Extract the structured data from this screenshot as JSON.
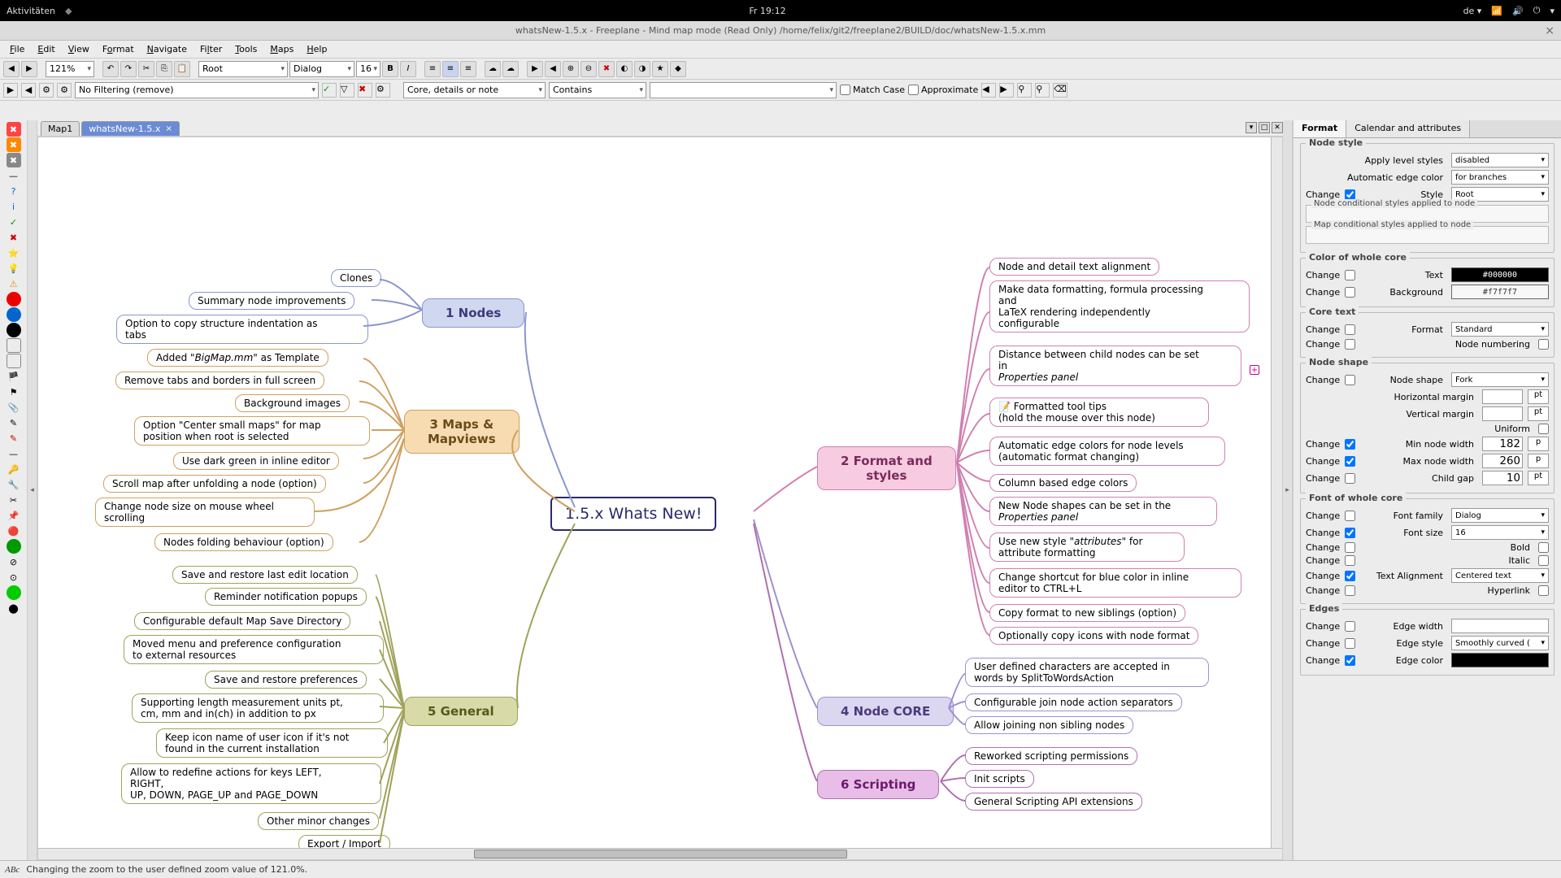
{
  "topbar": {
    "activities": "Aktivitäten",
    "clock": "Fr 19:12",
    "lang": "de ▾"
  },
  "titlebar": {
    "text": "whatsNew-1.5.x - Freeplane - Mind map mode (Read Only) /home/felix/git2/freeplane2/BUILD/doc/whatsNew-1.5.x.mm"
  },
  "menu": [
    "File",
    "Edit",
    "View",
    "Format",
    "Navigate",
    "Filter",
    "Tools",
    "Maps",
    "Help"
  ],
  "toolbar": {
    "zoom": "121%",
    "style": "Root",
    "font": "Dialog",
    "fsize": "16"
  },
  "filter": {
    "mode": "No Filtering (remove)",
    "scope": "Core, details or note",
    "op": "Contains",
    "matchcase": "Match Case",
    "approx": "Approximate"
  },
  "tabs": {
    "t1": "Map1",
    "t2": "whatsNew-1.5.x"
  },
  "root": "1.5.x Whats New!",
  "branches": {
    "n1": "1 Nodes",
    "n3": "3 Maps &\nMapviews",
    "n5": "5 General",
    "n2": "2 Format and\nstyles",
    "n4": "4 Node CORE",
    "n6": "6 Scripting"
  },
  "n1leaves": [
    "Clones",
    "Summary node improvements",
    "Option to copy structure indentation as\ntabs"
  ],
  "n3leaves": [
    "Added \"BigMap.mm\" as Template",
    "Remove tabs and borders in full screen",
    "Background images",
    "Option \"Center small maps\" for map\nposition when root is selected",
    "Use dark green in inline editor",
    "Scroll map after unfolding a node (option)",
    "Change node size on mouse wheel\nscrolling",
    "Nodes folding behaviour (option)"
  ],
  "n5leaves": [
    "Save and restore last edit location",
    "Reminder notification popups",
    "Configurable default Map Save Directory",
    "Moved menu and preference configuration\nto external resources",
    "Save and restore preferences",
    "Supporting length measurement units pt,\ncm, mm and in(ch) in addition to px",
    "Keep icon name of user icon if it's not\nfound in the current installation",
    "Allow to redefine actions for keys LEFT,\nRIGHT,\nUP, DOWN, PAGE_UP and PAGE_DOWN",
    "Other minor changes",
    "Export / Import"
  ],
  "n2leaves": [
    "Node and detail text alignment",
    "Make data formatting, formula processing\nand\nLaTeX rendering independently\nconfigurable",
    "Distance between child nodes can be set\nin\nProperties panel",
    "📝 Formatted tool tips\n(hold the mouse over this node)",
    "Automatic edge colors for node levels\n(automatic format changing)",
    "Column based edge colors",
    "New Node shapes can be set in the\nProperties panel",
    "Use new style \"attributes\" for\nattribute formatting",
    "Change shortcut for blue color in inline\neditor to CTRL+L",
    "Copy format to new siblings (option)",
    "Optionally copy icons with node format"
  ],
  "n4leaves": [
    "User defined characters are accepted in\nwords by SplitToWordsAction",
    "Configurable join node action separators",
    "Allow joining non sibling nodes"
  ],
  "n6leaves": [
    "Reworked scripting permissions",
    "Init scripts",
    "General Scripting API extensions"
  ],
  "panel": {
    "tab1": "Format",
    "tab2": "Calendar and attributes",
    "s_nodestyle": "Node style",
    "apply_level": "Apply level styles",
    "apply_level_v": "disabled",
    "auto_edge": "Automatic edge color",
    "auto_edge_v": "for branches",
    "change": "Change",
    "style": "Style",
    "style_v": "Root",
    "ncond": "Node conditional styles applied to node",
    "mcond": "Map conditional styles applied to node",
    "s_color": "Color of whole core",
    "text": "Text",
    "text_v": "#000000",
    "bg": "Background",
    "bg_v": "#f7f7f7",
    "s_coretext": "Core text",
    "format": "Format",
    "format_v": "Standard",
    "numbering": "Node numbering",
    "s_shape": "Node shape",
    "nshape": "Node shape",
    "nshape_v": "Fork",
    "hmargin": "Horizontal margin",
    "vmargin": "Vertical margin",
    "uniform": "Uniform",
    "minw": "Min node width",
    "minw_v": "182",
    "maxw": "Max node width",
    "maxw_v": "260",
    "cgap": "Child gap",
    "cgap_v": "10",
    "pt": "pt",
    "s_font": "Font of whole core",
    "ffam": "Font family",
    "ffam_v": "Dialog",
    "fsize": "Font size",
    "fsize_v": "16",
    "bold": "Bold",
    "italic": "Italic",
    "talign": "Text Alignment",
    "talign_v": "Centered text",
    "hyper": "Hyperlink",
    "s_edges": "Edges",
    "ewidth": "Edge width",
    "estyle": "Edge style",
    "estyle_v": "Smoothly curved (",
    "ecolor": "Edge color"
  },
  "status": "Changing the zoom to the user defined zoom value of 121.0%."
}
